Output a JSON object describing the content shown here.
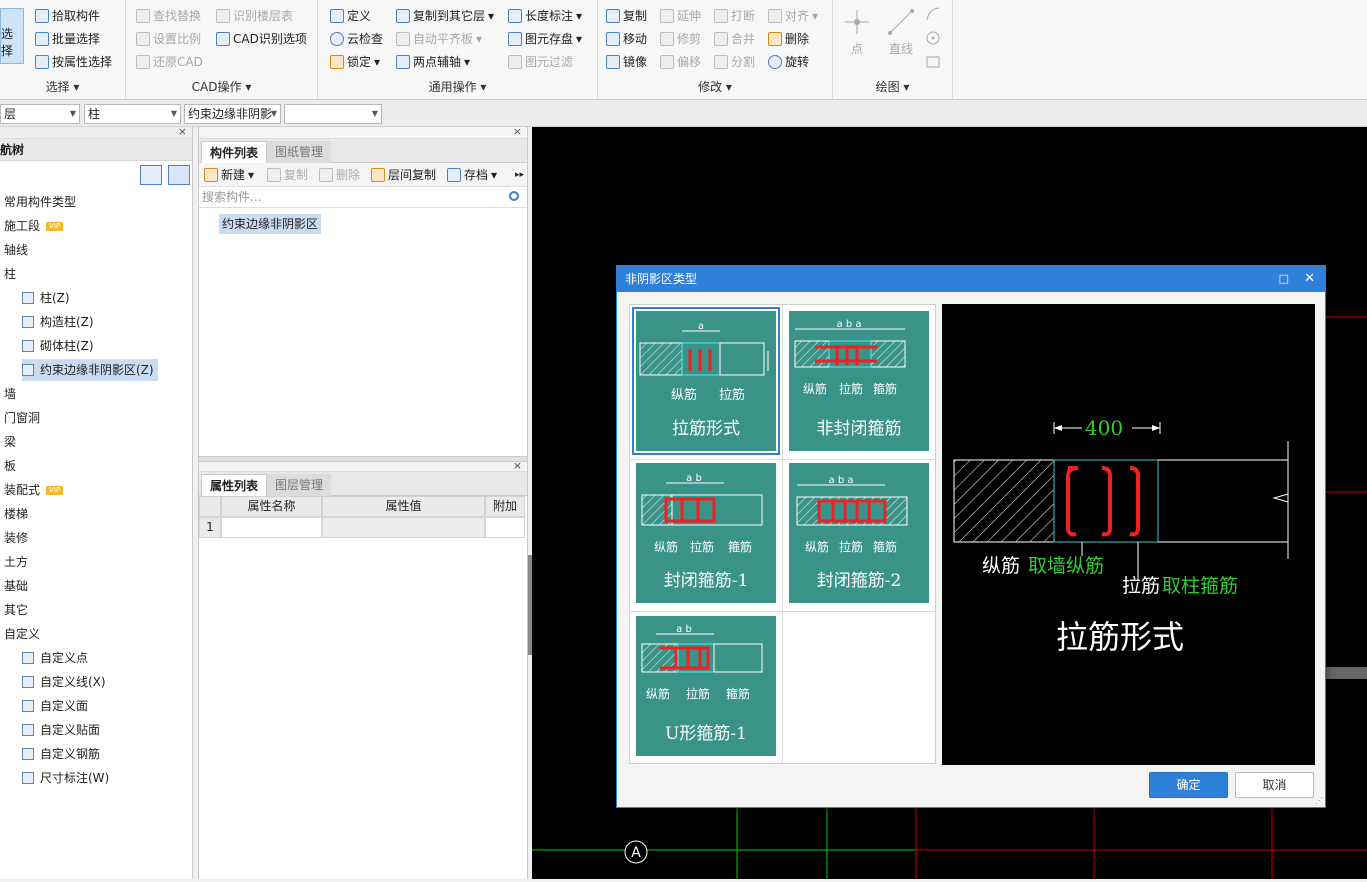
{
  "ribbon": {
    "select_group": {
      "title": "选择",
      "select_big": "选择",
      "items": [
        "拾取构件",
        "批量选择",
        "按属性选择"
      ]
    },
    "cad_group": {
      "title": "CAD操作",
      "items": [
        "查找替换",
        "识别楼层表",
        "设置比例",
        "CAD识别选项",
        "还原CAD"
      ]
    },
    "common_group": {
      "title": "通用操作",
      "items": [
        "定义",
        "复制到其它层",
        "长度标注",
        "云检查",
        "自动平齐板",
        "图元存盘",
        "锁定",
        "两点辅轴",
        "图元过滤"
      ]
    },
    "modify_group": {
      "title": "修改",
      "items": [
        "复制",
        "延伸",
        "打断",
        "对齐",
        "移动",
        "修剪",
        "合并",
        "删除",
        "镜像",
        "偏移",
        "分割",
        "旋转"
      ]
    },
    "draw_group": {
      "title": "绘图",
      "items": [
        "点",
        "直线"
      ]
    }
  },
  "combos": [
    "层",
    "柱",
    "约束边缘非阴影",
    ""
  ],
  "left_panel": {
    "header": "航树",
    "items": [
      {
        "label": "常用构件类型",
        "level": 0
      },
      {
        "label": "施工段",
        "level": 0,
        "vip": "VIP"
      },
      {
        "label": "轴线",
        "level": 0
      },
      {
        "label": "柱",
        "level": 0
      },
      {
        "label": "柱(Z)",
        "level": 1
      },
      {
        "label": "构造柱(Z)",
        "level": 1
      },
      {
        "label": "砌体柱(Z)",
        "level": 1
      },
      {
        "label": "约束边缘非阴影区(Z)",
        "level": 1,
        "selected": true
      },
      {
        "label": "墙",
        "level": 0
      },
      {
        "label": "门窗洞",
        "level": 0
      },
      {
        "label": "梁",
        "level": 0
      },
      {
        "label": "板",
        "level": 0
      },
      {
        "label": "装配式",
        "level": 0,
        "vip": "VIP"
      },
      {
        "label": "楼梯",
        "level": 0
      },
      {
        "label": "装修",
        "level": 0
      },
      {
        "label": "土方",
        "level": 0
      },
      {
        "label": "基础",
        "level": 0
      },
      {
        "label": "其它",
        "level": 0
      },
      {
        "label": "自定义",
        "level": 0
      },
      {
        "label": "自定义点",
        "level": 1
      },
      {
        "label": "自定义线(X)",
        "level": 1
      },
      {
        "label": "自定义面",
        "level": 1
      },
      {
        "label": "自定义贴面",
        "level": 1
      },
      {
        "label": "自定义钢筋",
        "level": 1
      },
      {
        "label": "尺寸标注(W)",
        "level": 1
      }
    ]
  },
  "component_panel": {
    "tabs": [
      "构件列表",
      "图纸管理"
    ],
    "toolbar": [
      "新建",
      "复制",
      "删除",
      "层间复制",
      "存档"
    ],
    "search_placeholder": "搜索构件...",
    "items": [
      "约束边缘非阴影区"
    ]
  },
  "property_panel": {
    "tabs": [
      "属性列表",
      "图层管理"
    ],
    "columns": [
      "属性名称",
      "属性值",
      "附加"
    ],
    "rows": [
      {
        "index": "1",
        "name": "",
        "value": "",
        "extra": ""
      }
    ]
  },
  "canvas": {
    "axis_label": "A"
  },
  "dialog": {
    "title": "非阴影区类型",
    "cards": [
      {
        "label": "拉筋形式",
        "dim": "a",
        "notes": [
          "纵筋",
          "拉筋"
        ]
      },
      {
        "label": "非封闭箍筋",
        "dim": "a b a",
        "notes": [
          "纵筋",
          "拉筋",
          "箍筋"
        ]
      },
      {
        "label": "封闭箍筋-1",
        "dim": "a b",
        "notes": [
          "纵筋",
          "拉筋",
          "箍筋"
        ]
      },
      {
        "label": "封闭箍筋-2",
        "dim": "a b a",
        "notes": [
          "纵筋",
          "拉筋",
          "箍筋"
        ]
      },
      {
        "label": "U形箍筋-1",
        "dim": "a b",
        "notes": [
          "纵筋",
          "拉筋",
          "箍筋"
        ]
      }
    ],
    "preview": {
      "dimension": "400",
      "note1_white": "纵筋",
      "note1_green": "取墙纵筋",
      "note2_white": "拉筋",
      "note2_green": "取柱箍筋",
      "caption": "拉筋形式"
    },
    "ok_label": "确定",
    "cancel_label": "取消"
  }
}
